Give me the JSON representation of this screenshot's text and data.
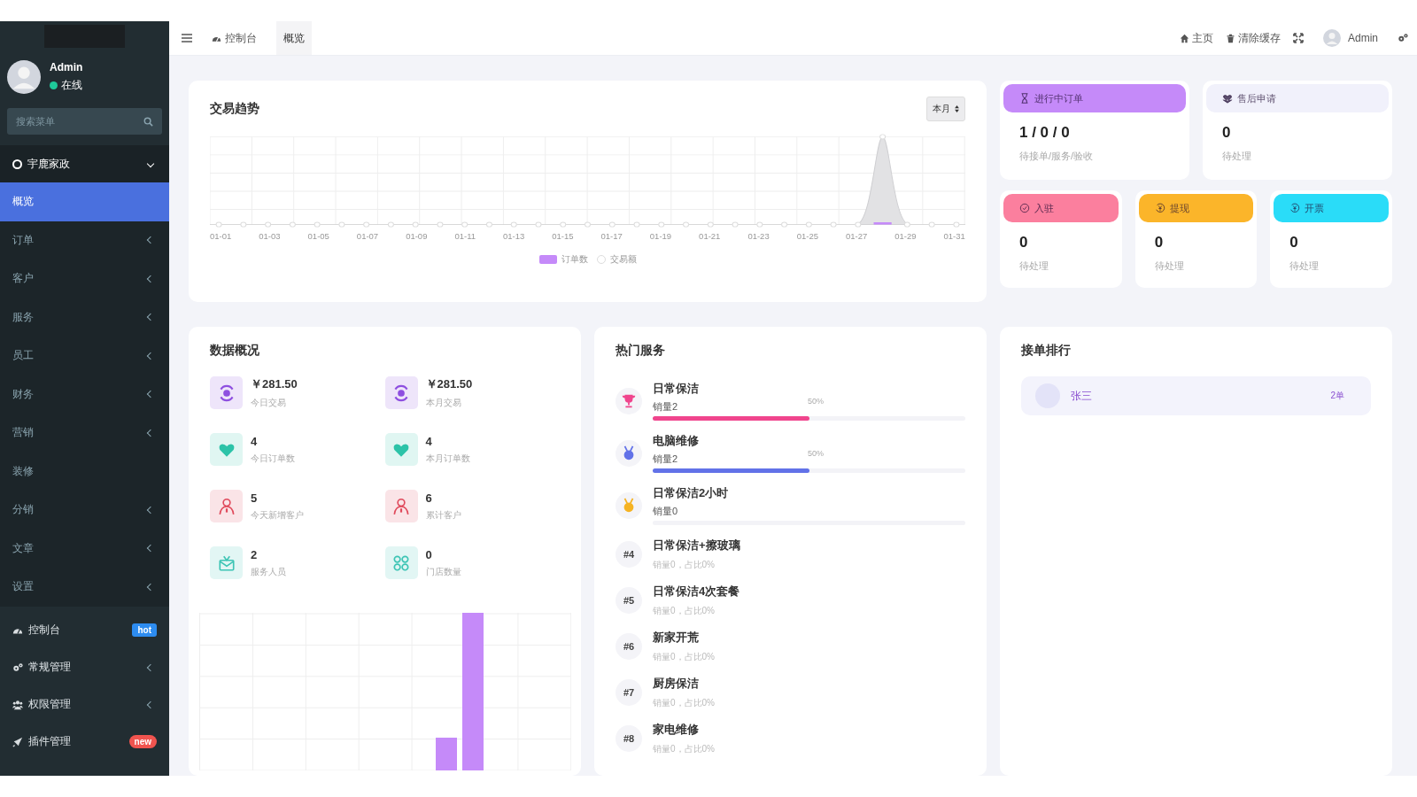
{
  "sidebar": {
    "user": {
      "name": "Admin",
      "status": "在线",
      "online": true
    },
    "search": {
      "placeholder": "搜索菜单"
    },
    "group": {
      "label": "宇鹿家政",
      "expanded": true,
      "children": [
        {
          "label": "概览",
          "selected": true,
          "has_submenu": false
        },
        {
          "label": "订单",
          "selected": false,
          "has_submenu": true
        },
        {
          "label": "客户",
          "selected": false,
          "has_submenu": true
        },
        {
          "label": "服务",
          "selected": false,
          "has_submenu": true
        },
        {
          "label": "员工",
          "selected": false,
          "has_submenu": true
        },
        {
          "label": "财务",
          "selected": false,
          "has_submenu": true
        },
        {
          "label": "营销",
          "selected": false,
          "has_submenu": true
        },
        {
          "label": "装修",
          "selected": false,
          "has_submenu": false
        },
        {
          "label": "分销",
          "selected": false,
          "has_submenu": true
        },
        {
          "label": "文章",
          "selected": false,
          "has_submenu": true
        },
        {
          "label": "设置",
          "selected": false,
          "has_submenu": true
        }
      ]
    },
    "bottom_menu": [
      {
        "label": "控制台",
        "has_submenu": false,
        "badge": "hot",
        "color": "#2d8cf0"
      },
      {
        "label": "常规管理",
        "has_submenu": true
      },
      {
        "label": "权限管理",
        "has_submenu": true
      },
      {
        "label": "插件管理",
        "has_submenu": false,
        "badge": "new",
        "color": "#f0544f"
      }
    ]
  },
  "topbar": {
    "tabs": [
      {
        "label": "控制台",
        "selected": false
      },
      {
        "label": "概览",
        "selected": true
      }
    ],
    "actions": [
      {
        "label": "主页"
      },
      {
        "label": "清除缓存"
      }
    ],
    "user": "Admin"
  },
  "trend": {
    "title": "交易趋势",
    "range": "本月",
    "x_labels": [
      "01-01",
      "01-03",
      "01-05",
      "01-07",
      "01-09",
      "01-11",
      "01-13",
      "01-15",
      "01-17",
      "01-19",
      "01-21",
      "01-23",
      "01-25",
      "01-27",
      "01-29",
      "01-31"
    ],
    "legend": [
      {
        "label": "订单数",
        "kind": "bar"
      },
      {
        "label": "交易额",
        "kind": "line"
      }
    ]
  },
  "status_cards": [
    {
      "title": "进行中订单",
      "color": "#c58af9",
      "value": "1 / 0 / 0",
      "caption": "待接单/服务/验收"
    },
    {
      "title": "售后申请",
      "color": "#f1f1fb",
      "value": "0",
      "caption": "待处理"
    },
    {
      "title": "入驻",
      "color": "#fb7f9e",
      "value": "0",
      "caption": "待处理"
    },
    {
      "title": "提现",
      "color": "#fbb52a",
      "value": "0",
      "caption": "待处理"
    },
    {
      "title": "开票",
      "color": "#2adcf8",
      "value": "0",
      "caption": "待处理"
    }
  ],
  "overview": {
    "title": "数据概况",
    "stats": [
      {
        "value": "￥281.50",
        "caption": "今日交易",
        "kind": "money",
        "color": "#8e4fe0"
      },
      {
        "value": "￥281.50",
        "caption": "本月交易",
        "kind": "money",
        "color": "#8e4fe0"
      },
      {
        "value": "4",
        "caption": "今日订单数",
        "kind": "heart",
        "color": "#2cc3a8"
      },
      {
        "value": "4",
        "caption": "本月订单数",
        "kind": "heart",
        "color": "#2cc3a8"
      },
      {
        "value": "5",
        "caption": "今天新增客户",
        "kind": "person",
        "color": "#e04a5c"
      },
      {
        "value": "6",
        "caption": "累计客户",
        "kind": "person",
        "color": "#e04a5c"
      },
      {
        "value": "2",
        "caption": "服务人员",
        "kind": "gift",
        "color": "#3cc4b4"
      },
      {
        "value": "0",
        "caption": "门店数量",
        "kind": "grid",
        "color": "#3cc4b4"
      }
    ]
  },
  "services": {
    "title": "热门服务",
    "items": [
      {
        "name": "日常保洁",
        "kind": "bar",
        "sales": "销量2",
        "percent": "50%",
        "level": 0.5,
        "color": "#f0458d"
      },
      {
        "name": "电脑维修",
        "kind": "bar",
        "sales": "销量2",
        "percent": "50%",
        "level": 0.5,
        "color": "#6272e8"
      },
      {
        "name": "日常保洁2小时",
        "kind": "bar",
        "sales": "销量0",
        "level": 0,
        "color": "#f5b323"
      },
      {
        "name": "日常保洁+擦玻璃",
        "kind": "plain",
        "rank": "#4",
        "sales": "销量0，占比0%"
      },
      {
        "name": "日常保洁4次套餐",
        "kind": "plain",
        "rank": "#5",
        "sales": "销量0，占比0%"
      },
      {
        "name": "新家开荒",
        "kind": "plain",
        "rank": "#6",
        "sales": "销量0，占比0%"
      },
      {
        "name": "厨房保洁",
        "kind": "plain",
        "rank": "#7",
        "sales": "销量0，占比0%"
      },
      {
        "name": "家电维修",
        "kind": "plain",
        "rank": "#8",
        "sales": "销量0，占比0%"
      }
    ]
  },
  "ranking": {
    "title": "接单排行",
    "rows": [
      {
        "name": "张三",
        "count": "2单"
      }
    ]
  }
}
